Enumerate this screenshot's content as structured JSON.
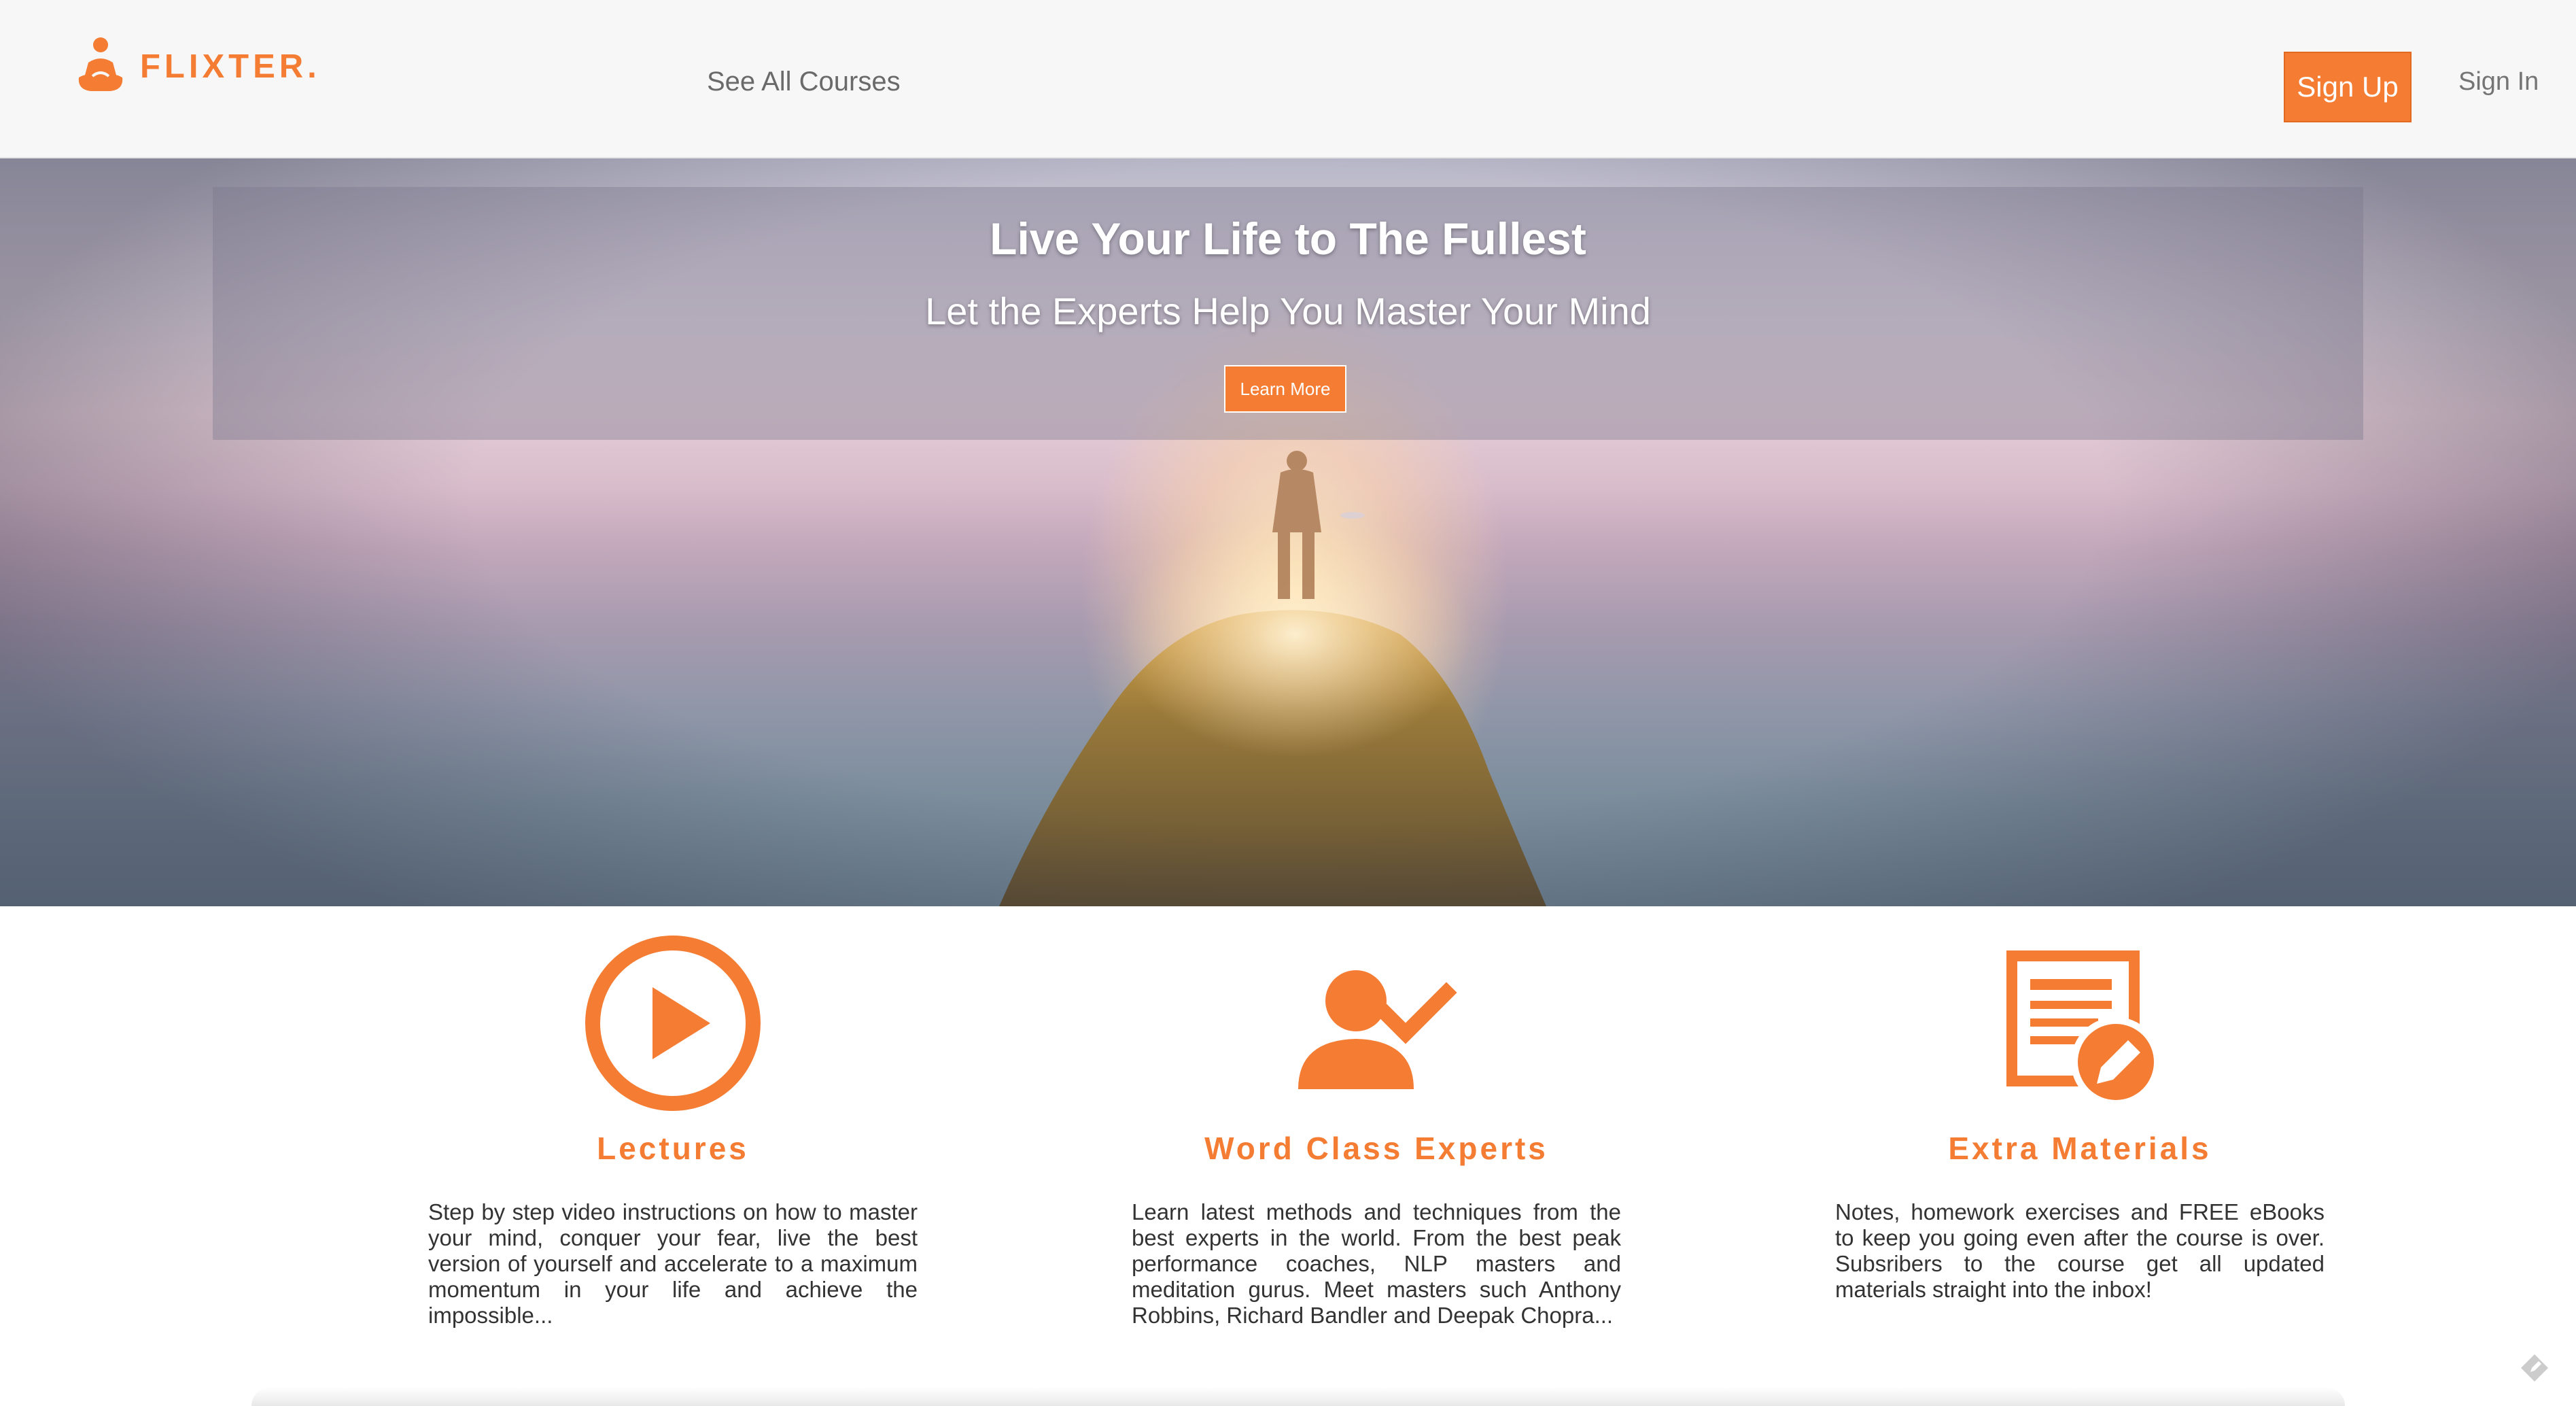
{
  "header": {
    "brand_name": "FLIXTER.",
    "nav_courses": "See All Courses",
    "signup_label": "Sign Up",
    "signin_label": "Sign In"
  },
  "hero": {
    "title": "Live Your Life to The Fullest",
    "subtitle": "Let the Experts Help You Master Your Mind",
    "cta_label": "Learn More"
  },
  "features": [
    {
      "icon": "play-circle-icon",
      "title": "Lectures",
      "text": "Step by step video instructions on how to master your mind, conquer your fear, live the best version of yourself and accelerate to a maximum momentum in your life and achieve the impossible..."
    },
    {
      "icon": "user-check-icon",
      "title": "Word Class Experts",
      "text": "Learn latest methods and techniques from the best experts in the world. From the best peak performance coaches, NLP masters and meditation gurus. Meet masters such Anthony Robbins, Richard Bandler and Deepak Chopra..."
    },
    {
      "icon": "document-edit-icon",
      "title": "Extra Materials",
      "text": "Notes, homework exercises and FREE eBooks to keep you going even after the course is over. Subsribers to the course get all updated materials straight into the inbox!"
    }
  ],
  "colors": {
    "accent": "#f47c33",
    "header_bg": "#f7f7f8",
    "body_text": "#333333"
  }
}
